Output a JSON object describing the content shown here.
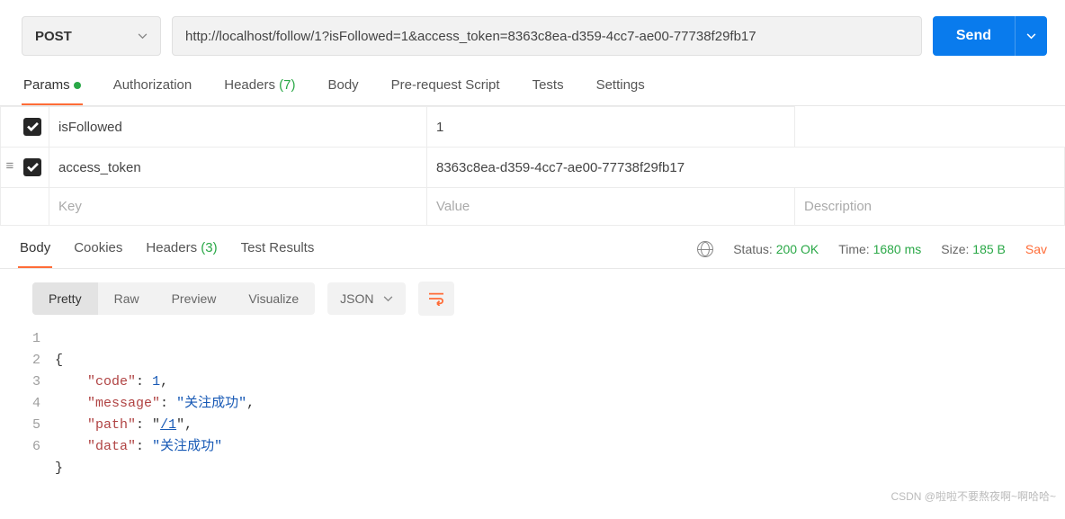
{
  "request": {
    "method": "POST",
    "url": "http://localhost/follow/1?isFollowed=1&access_token=8363c8ea-d359-4cc7-ae00-77738f29fb17",
    "send_label": "Send"
  },
  "request_tabs": [
    "Params",
    "Authorization",
    "Headers",
    "Body",
    "Pre-request Script",
    "Tests",
    "Settings"
  ],
  "headers_count": "(7)",
  "params": {
    "rows": [
      {
        "key": "isFollowed",
        "value": "1"
      },
      {
        "key": "access_token",
        "value": "8363c8ea-d359-4cc7-ae00-77738f29fb17"
      }
    ],
    "placeholders": {
      "key": "Key",
      "value": "Value",
      "desc": "Description"
    }
  },
  "response_tabs": [
    "Body",
    "Cookies",
    "Headers",
    "Test Results"
  ],
  "resp_headers_count": "(3)",
  "status": {
    "label": "Status:",
    "value": "200 OK"
  },
  "time": {
    "label": "Time:",
    "value": "1680 ms"
  },
  "size": {
    "label": "Size:",
    "value": "185 B"
  },
  "save_label": "Sav",
  "view_tabs": [
    "Pretty",
    "Raw",
    "Preview",
    "Visualize"
  ],
  "format": "JSON",
  "json_lines": {
    "l1": "{",
    "l2a": "\"code\"",
    "l2b": ": ",
    "l2c": "1",
    "l2d": ",",
    "l3a": "\"message\"",
    "l3b": ": ",
    "l3c": "\"关注成功\"",
    "l3d": ",",
    "l4a": "\"path\"",
    "l4b": ": \"",
    "l4c": "/1",
    "l4d": "\",",
    "l5a": "\"data\"",
    "l5b": ": ",
    "l5c": "\"关注成功\"",
    "l6": "}"
  },
  "watermark": "CSDN @啦啦不要熬夜啊~啊哈哈~"
}
